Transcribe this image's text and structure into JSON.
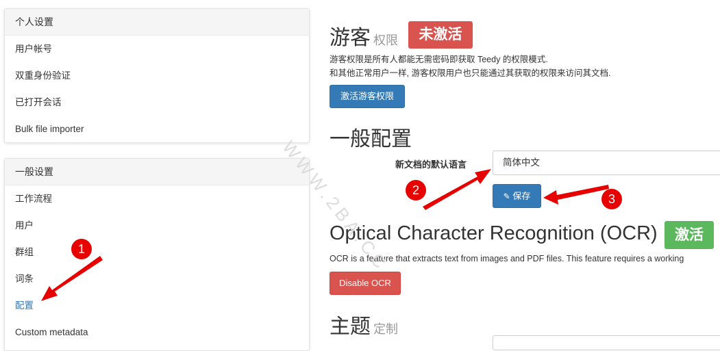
{
  "sidebar": {
    "personal": {
      "title": "个人设置",
      "items": [
        {
          "label": "用户帐号"
        },
        {
          "label": "双重身份验证"
        },
        {
          "label": "已打开会话"
        },
        {
          "label": "Bulk file importer"
        }
      ]
    },
    "general": {
      "title": "一般设置",
      "items": [
        {
          "label": "工作流程"
        },
        {
          "label": "用户"
        },
        {
          "label": "群组"
        },
        {
          "label": "词条"
        },
        {
          "label": "配置",
          "active": true
        },
        {
          "label": "Custom metadata"
        }
      ]
    }
  },
  "guest": {
    "title": "游客",
    "subtitle": "权限",
    "badge": "未激活",
    "desc_line1": "游客权限是所有人都能无需密码即获取 Teedy 的权限模式.",
    "desc_line2": "和其他正常用户一样, 游客权限用户也只能通过其获取的权限来访问其文档.",
    "button": "激活游客权限"
  },
  "general_config": {
    "title": "一般配置",
    "language_label": "新文档的默认语言",
    "language_value": "简体中文",
    "save_button": "保存"
  },
  "ocr": {
    "title": "Optical Character Recognition (OCR)",
    "badge": "激活",
    "desc": "OCR is a feature that extracts text from images and PDF files. This feature requires a working",
    "button": "Disable OCR"
  },
  "theme": {
    "title": "主题",
    "subtitle": "定制"
  },
  "annotations": {
    "n1": "1",
    "n2": "2",
    "n3": "3"
  },
  "watermark": "WWW.2BA.CC",
  "colors": {
    "primary": "#337ab7",
    "danger": "#d9534f",
    "success": "#5cb85c",
    "annotation": "#e60000"
  }
}
